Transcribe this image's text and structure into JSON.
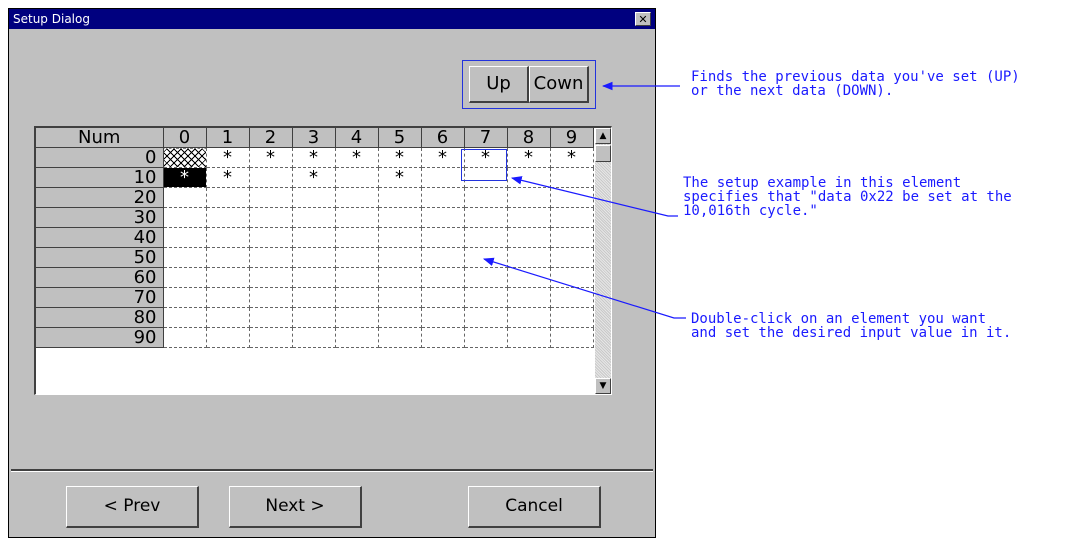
{
  "dialog": {
    "title": "Setup Dialog",
    "close_label": "✕"
  },
  "toolbar": {
    "up_label": "Up",
    "down_label": "Cown"
  },
  "grid": {
    "corner_label": "Num",
    "columns": [
      "0",
      "1",
      "2",
      "3",
      "4",
      "5",
      "6",
      "7",
      "8",
      "9"
    ],
    "rows": [
      {
        "label": "0",
        "cells": [
          "",
          "*",
          "*",
          "*",
          "*",
          "*",
          "*",
          "*",
          "*",
          "*"
        ]
      },
      {
        "label": "10",
        "cells": [
          "*",
          "*",
          "",
          "*",
          "",
          "*",
          "",
          "",
          "",
          ""
        ]
      },
      {
        "label": "20",
        "cells": [
          "",
          "",
          "",
          "",
          "",
          "",
          "",
          "",
          "",
          ""
        ]
      },
      {
        "label": "30",
        "cells": [
          "",
          "",
          "",
          "",
          "",
          "",
          "",
          "",
          "",
          ""
        ]
      },
      {
        "label": "40",
        "cells": [
          "",
          "",
          "",
          "",
          "",
          "",
          "",
          "",
          "",
          ""
        ]
      },
      {
        "label": "50",
        "cells": [
          "",
          "",
          "",
          "",
          "",
          "",
          "",
          "",
          "",
          ""
        ]
      },
      {
        "label": "60",
        "cells": [
          "",
          "",
          "",
          "",
          "",
          "",
          "",
          "",
          "",
          ""
        ]
      },
      {
        "label": "70",
        "cells": [
          "",
          "",
          "",
          "",
          "",
          "",
          "",
          "",
          "",
          ""
        ]
      },
      {
        "label": "80",
        "cells": [
          "",
          "",
          "",
          "",
          "",
          "",
          "",
          "",
          "",
          ""
        ]
      },
      {
        "label": "90",
        "cells": [
          "",
          "",
          "",
          "",
          "",
          "",
          "",
          "",
          "",
          ""
        ]
      }
    ]
  },
  "scrollbar": {
    "up_icon": "▲",
    "down_icon": "▼"
  },
  "footer": {
    "prev_label": "< Prev",
    "next_label": "Next >",
    "cancel_label": "Cancel"
  },
  "annotations": {
    "note_updown": "Finds the previous data you've set (UP)\nor the next data (DOWN).",
    "note_element": "The setup example in this element\nspecifies that \"data 0x22 be set at the\n10,016th cycle.\"",
    "note_doubleclick": "Double-click on an element you want\nand set the desired input value in it.",
    "color": "#1a1aff"
  },
  "colors": {
    "dialog_face": "#c0c0c0",
    "titlebar": "#00007f",
    "highlight": "#2233dd"
  }
}
